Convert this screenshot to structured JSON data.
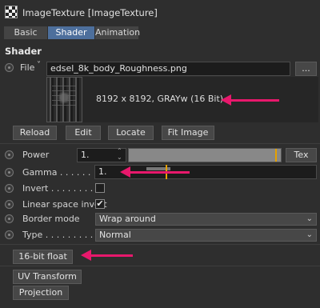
{
  "window": {
    "title": "ImageTexture [ImageTexture]"
  },
  "tabs": [
    {
      "label": "Basic"
    },
    {
      "label": "Shader"
    },
    {
      "label": "Animation"
    }
  ],
  "section": {
    "title": "Shader"
  },
  "file": {
    "label": "File",
    "value": "edsel_8k_body_Roughness.png",
    "browse_label": "...",
    "info": "8192 x 8192, GRAYw (16 Bit)"
  },
  "file_buttons": {
    "reload": "Reload",
    "edit": "Edit",
    "locate": "Locate",
    "fit_image": "Fit Image"
  },
  "params": {
    "power": {
      "label": "Power",
      "value": "1.",
      "tex_label": "Tex",
      "slider_fraction": 1.0
    },
    "gamma": {
      "label": "Gamma . . . . . . . .",
      "value": "1."
    },
    "invert": {
      "label": "Invert . . . . . . . . .",
      "checked": false
    },
    "linear_space_invert": {
      "label": "Linear space invert",
      "checked": true,
      "mark": "✔"
    },
    "border_mode": {
      "label": "Border mode",
      "value": "Wrap around"
    },
    "type": {
      "label": "Type . . . . . . . . . .",
      "value": "Normal"
    }
  },
  "bit_float_button": "16-bit float",
  "uv_transform_button": "UV Transform",
  "projection_button": "Projection",
  "colors": {
    "accent": "#4d6f9c",
    "annotation": "#e8186c",
    "slider_marker": "#e6a100"
  }
}
